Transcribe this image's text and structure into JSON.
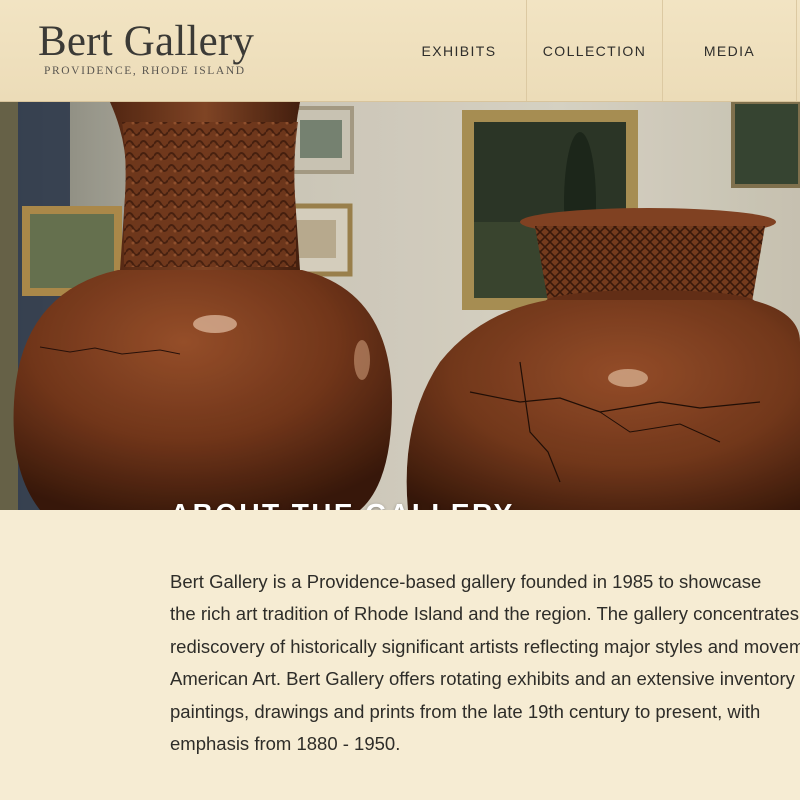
{
  "header": {
    "logo_title": "Bert Gallery",
    "logo_subtitle": "PROVIDENCE, RHODE ISLAND",
    "nav": [
      {
        "label": "EXHIBITS"
      },
      {
        "label": "COLLECTION"
      },
      {
        "label": "MEDIA"
      }
    ]
  },
  "hero": {
    "title": "ABOUT THE GALLERY"
  },
  "about": {
    "lines": [
      "Bert Gallery is a Providence-based gallery founded in 1985 to showcase",
      "the rich art tradition of Rhode Island and the region. The gallery concentrates",
      "rediscovery of historically significant artists reflecting major styles and movements in",
      "American Art. Bert Gallery offers rotating exhibits and an extensive inventory of",
      "paintings, drawings and prints from the late 19th century to present, with",
      "emphasis from 1880 - 1950."
    ]
  },
  "colors": {
    "header_bg": "#efe0bd",
    "page_bg": "#f6ecd3",
    "text": "#2e2d29",
    "vase": "#7a3f22"
  }
}
